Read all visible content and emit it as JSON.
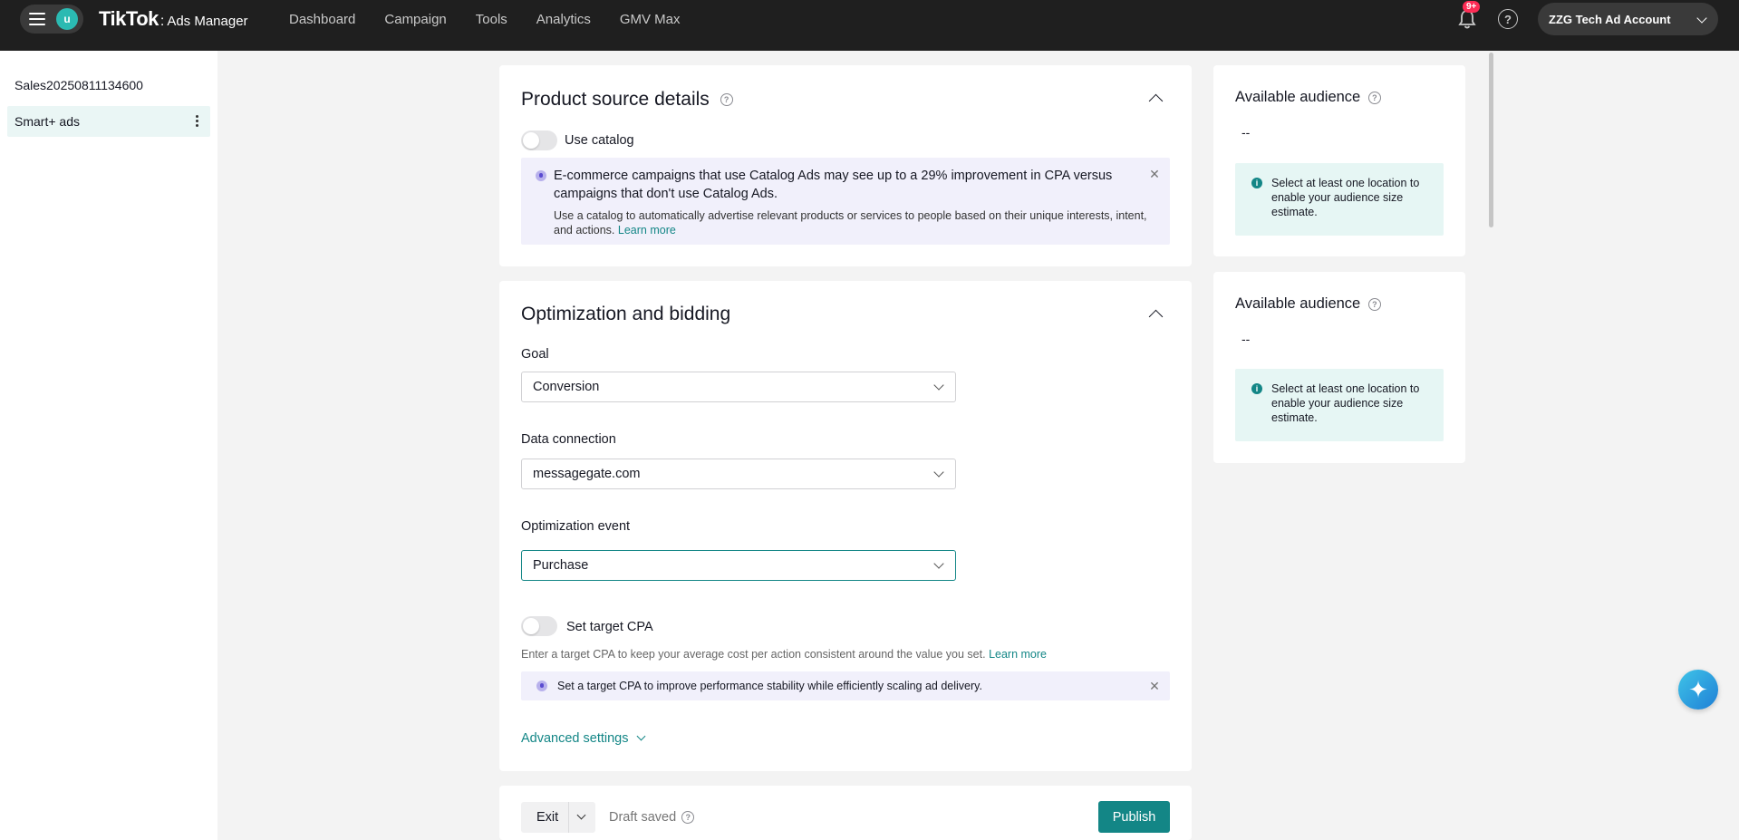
{
  "header": {
    "avatar_initial": "u",
    "logo_main": "TikTok",
    "logo_sep": ":",
    "logo_sub": "Ads Manager",
    "nav": [
      "Dashboard",
      "Campaign",
      "Tools",
      "Analytics",
      "GMV Max"
    ],
    "notification_badge": "9+",
    "account_name": "ZZG Tech Ad Account"
  },
  "sidebar": {
    "items": [
      {
        "label": "Sales20250811134600"
      },
      {
        "label": "Smart+ ads"
      }
    ]
  },
  "product_source": {
    "title": "Product source details",
    "use_catalog_label": "Use catalog",
    "banner_heading": "E-commerce campaigns that use Catalog Ads may see up to a 29% improvement in CPA versus campaigns that don't use Catalog Ads.",
    "banner_body": "Use a catalog to automatically advertise relevant products or services to people based on their unique interests, intent, and actions.",
    "banner_link": "Learn more"
  },
  "optimization": {
    "title": "Optimization and bidding",
    "goal_label": "Goal",
    "goal_value": "Conversion",
    "data_connection_label": "Data connection",
    "data_connection_value": "messagegate.com",
    "event_label": "Optimization event",
    "event_value": "Purchase",
    "target_cpa_label": "Set target CPA",
    "target_cpa_help": "Enter a target CPA to keep your average cost per action consistent around the value you set.",
    "target_cpa_link": "Learn more",
    "cpa_banner": "Set a target CPA to improve performance stability while efficiently scaling ad delivery.",
    "advanced_settings": "Advanced settings"
  },
  "audience_panels": [
    {
      "title": "Available audience",
      "value": "--",
      "note": "Select at least one location to enable your audience size estimate."
    },
    {
      "title": "Available audience",
      "value": "--",
      "note": "Select at least one location to enable your audience size estimate."
    }
  ],
  "footer": {
    "exit_label": "Exit",
    "draft_status": "Draft saved",
    "publish_label": "Publish"
  },
  "colors": {
    "accent": "#138686",
    "topbar": "#1f1f1f",
    "badge": "#fe2c55",
    "info_purple_bg": "#f1f0fb",
    "info_teal_bg": "#e6f6f4"
  }
}
